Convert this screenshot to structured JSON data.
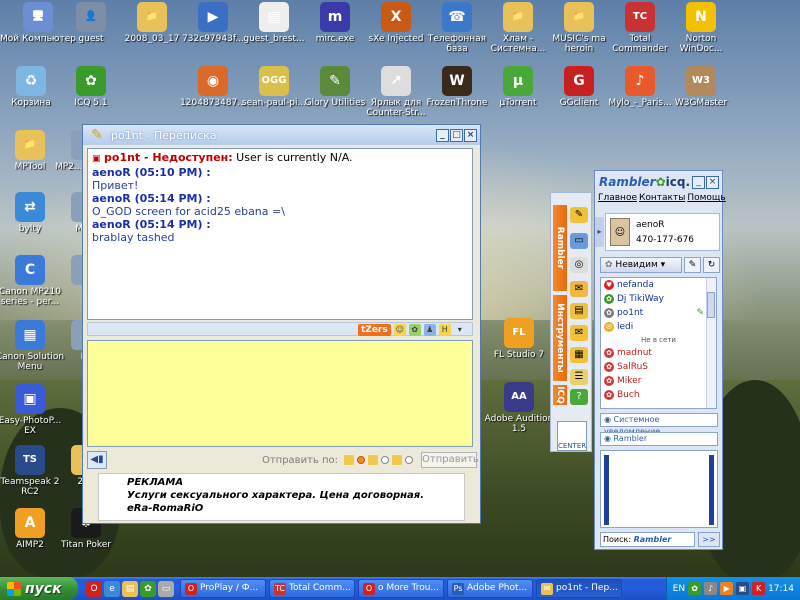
{
  "desktop": {
    "icons": [
      {
        "label": "Мой Компьютер",
        "icon": "my-computer-icon",
        "color": "#6c8fd4",
        "glyph": "🖥"
      },
      {
        "label": "guest",
        "icon": "user-folder-icon",
        "color": "#7d8ea8",
        "glyph": "👤"
      },
      {
        "label": "2008_03_17",
        "icon": "folder-icon",
        "color": "#e8c15a",
        "glyph": "📁"
      },
      {
        "label": "732c97943f...",
        "icon": "media-player-icon",
        "color": "#3a6fc4",
        "glyph": "▶"
      },
      {
        "label": "guest_brest...",
        "icon": "file-icon",
        "color": "#eeeeee",
        "glyph": "▤"
      },
      {
        "label": "mirc.exe",
        "icon": "mirc-icon",
        "color": "#3a3aa8",
        "glyph": "m"
      },
      {
        "label": "sXe Injected",
        "icon": "sxe-icon",
        "color": "#c85a16",
        "glyph": "X"
      },
      {
        "label": "Телефонная база",
        "icon": "phone-base-icon",
        "color": "#3a78c9",
        "glyph": "☎"
      },
      {
        "label": "Хлам - Системна...",
        "icon": "folder-icon",
        "color": "#e8c15a",
        "glyph": "📁"
      },
      {
        "label": "MUSIC's ma heroin",
        "icon": "folder-icon",
        "color": "#e8c15a",
        "glyph": "📁"
      },
      {
        "label": "Total Commander",
        "icon": "total-commander-icon",
        "color": "#c83232",
        "glyph": "TC"
      },
      {
        "label": "Norton WinDoc...",
        "icon": "norton-icon",
        "color": "#f2c200",
        "glyph": "N"
      },
      {
        "label": "Корзина",
        "icon": "recycle-bin-icon",
        "color": "#7cb6e2",
        "glyph": "♻"
      },
      {
        "label": "ICQ 5.1",
        "icon": "icq-icon",
        "color": "#3a9a2a",
        "glyph": "✿"
      },
      {
        "label": "",
        "icon": "",
        "color": "",
        "glyph": ""
      },
      {
        "label": "1204873487...",
        "icon": "image-icon",
        "color": "#d96a2a",
        "glyph": "◉"
      },
      {
        "label": "sean-paul-pi...",
        "icon": "ogg-audio-icon",
        "color": "#d8c04a",
        "glyph": "OGG"
      },
      {
        "label": "Glory Utilities",
        "icon": "glory-utilities-icon",
        "color": "#5a8a3a",
        "glyph": "✎"
      },
      {
        "label": "Ярлык для Counter-Str...",
        "icon": "shortcut-icon",
        "color": "#dddddd",
        "glyph": "↗"
      },
      {
        "label": "FrozenThrone",
        "icon": "frozen-throne-icon",
        "color": "#3a2a1a",
        "glyph": "W"
      },
      {
        "label": "µTorrent",
        "icon": "utorrent-icon",
        "color": "#4aa83a",
        "glyph": "µ"
      },
      {
        "label": "GGclient",
        "icon": "ggclient-icon",
        "color": "#c82020",
        "glyph": "G"
      },
      {
        "label": "Mylo_-_Paris...",
        "icon": "mp3-icon",
        "color": "#e85a2a",
        "glyph": "♪"
      },
      {
        "label": "W3GMaster",
        "icon": "w3gmaster-icon",
        "color": "#b08a5a",
        "glyph": "W3"
      },
      {
        "label": "MPTool",
        "icon": "folder-icon",
        "color": "#e8c15a",
        "glyph": "📁"
      },
      {
        "label": "MP2... Элек...",
        "icon": "printer-icon",
        "color": "#8aa0b8",
        "glyph": "P"
      },
      {
        "label": "bylty",
        "icon": "network-icon",
        "color": "#3a8ad8",
        "glyph": "⇄"
      },
      {
        "label": "MP P",
        "icon": "printer-icon",
        "color": "#8aa0b8",
        "glyph": "P"
      },
      {
        "label": "Canon MP210 series - per...",
        "icon": "canon-icon",
        "color": "#3a7ad8",
        "glyph": "C"
      },
      {
        "label": "M",
        "icon": "printer-icon",
        "color": "#8aa0b8",
        "glyph": "P"
      },
      {
        "label": "Canon Solution Menu",
        "icon": "canon-solution-icon",
        "color": "#3a7ad8",
        "glyph": "▦"
      },
      {
        "label": "Pe",
        "icon": "printer-icon",
        "color": "#8aa0b8",
        "glyph": "P"
      },
      {
        "label": "Easy-PhotoP... EX",
        "icon": "easy-photo-icon",
        "color": "#3a5ad8",
        "glyph": "▣"
      },
      {
        "label": "Teamspeak 2 RC2",
        "icon": "teamspeak-icon",
        "color": "#2a4a8a",
        "glyph": "TS"
      },
      {
        "label": "200",
        "icon": "folder-icon",
        "color": "#e8c15a",
        "glyph": "📁"
      },
      {
        "label": "AIMP2",
        "icon": "aimp-icon",
        "color": "#f0a020",
        "glyph": "A"
      },
      {
        "label": "Titan Poker",
        "icon": "titan-poker-icon",
        "color": "#1a1a1a",
        "glyph": "♠"
      },
      {
        "label": "FL Studio 7",
        "icon": "fl-studio-icon",
        "color": "#f0a020",
        "glyph": "FL"
      },
      {
        "label": "Adobe Audition 1.5",
        "icon": "adobe-audition-icon",
        "color": "#3a3a8a",
        "glyph": "AA"
      }
    ]
  },
  "chat": {
    "title": "po1nt - Переписка",
    "system_line": {
      "nick": "po1nt",
      "status": " - Недоступен:",
      "message": " User is currently N/A."
    },
    "messages": [
      {
        "header": "aenoR (05:10 PM) :",
        "body": "Привет!"
      },
      {
        "header": "aenoR (05:14 PM) :",
        "body": "O_GOD screen for acid25 ebana =\\"
      },
      {
        "header": "aenoR (05:14 PM) :",
        "body": "brablay tashed"
      }
    ],
    "tzers_label": "tZers",
    "send_by_label": "Отправить по:",
    "send_button": "Отправить",
    "ad": {
      "title": "РЕКЛАМА",
      "text": "Услуги сексуального характера. Цена договорная.",
      "signature": "eRa-RomaRiO"
    }
  },
  "strip": {
    "tab_top": "Rambler",
    "tab_mid": "Инструменты",
    "tab_bottom": "ICQ",
    "center_label": "CENTER"
  },
  "icq": {
    "brand_rambler": "Rambler",
    "brand_icq": "icq.",
    "menu": [
      "Главное",
      "Контакты",
      "Помощь"
    ],
    "profile": {
      "name": "aenoR",
      "uin": "470-177-676"
    },
    "status": "Невидим",
    "contacts_online": [
      {
        "name": "nefanda",
        "icon": "heart-icon",
        "color": "#e02020",
        "glyph": "♥"
      },
      {
        "name": "Dj TikiWay",
        "icon": "flower-icon",
        "color": "#3a9a2a",
        "glyph": "✿"
      },
      {
        "name": "po1nt",
        "icon": "flower-icon",
        "color": "#7a7a7a",
        "glyph": "✿"
      },
      {
        "name": "ledi",
        "icon": "message-icon",
        "color": "#e8b020",
        "glyph": "✉"
      }
    ],
    "group_label": "Не в сети",
    "contacts_offline": [
      {
        "name": "madnut",
        "icon": "flower-icon",
        "color": "#d03a3a",
        "glyph": "✿"
      },
      {
        "name": "SalRuS",
        "icon": "flower-icon",
        "color": "#d03a3a",
        "glyph": "✿"
      },
      {
        "name": "Miker",
        "icon": "flower-icon",
        "color": "#d03a3a",
        "glyph": "✿"
      },
      {
        "name": "Buch",
        "icon": "flower-icon",
        "color": "#d03a3a",
        "glyph": "✿"
      }
    ],
    "system_notice": "Системное уведомление",
    "rambler_tab": "Rambler",
    "search_label": "Поиск:",
    "search_brand": "Rambler",
    "search_go": ">>"
  },
  "taskbar": {
    "start_label": "пуск",
    "tasks": [
      {
        "label": "ProPlay / Ф...",
        "icon": "opera-icon",
        "color": "#d02020",
        "glyph": "O"
      },
      {
        "label": "Total Comm...",
        "icon": "total-commander-icon",
        "color": "#c83232",
        "glyph": "TC"
      },
      {
        "label": "о More Trou...",
        "icon": "opera-icon",
        "color": "#d02020",
        "glyph": "O"
      },
      {
        "label": "Adobe Phot...",
        "icon": "photoshop-icon",
        "color": "#2a5ab8",
        "glyph": "Ps"
      },
      {
        "label": "po1nt - Пер...",
        "icon": "icq-chat-icon",
        "color": "#e8c15a",
        "glyph": "✉"
      }
    ],
    "language": "EN",
    "clock": "17:14"
  }
}
